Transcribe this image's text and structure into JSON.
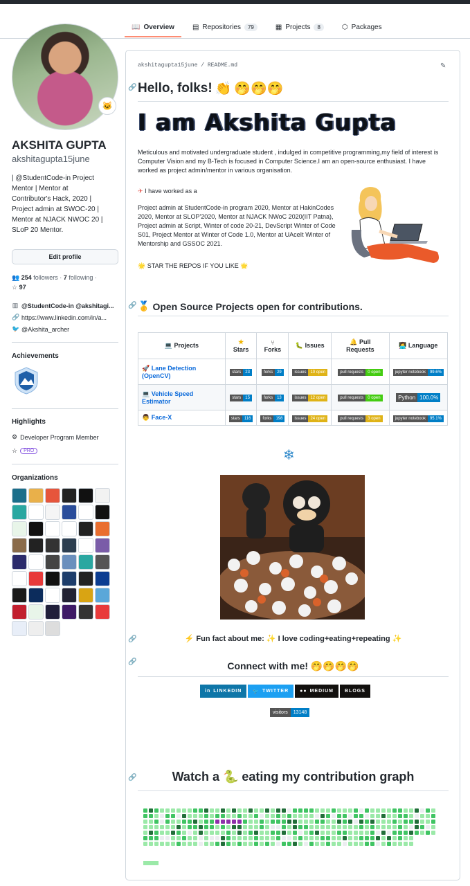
{
  "tabs": [
    {
      "label": "Overview",
      "count": ""
    },
    {
      "label": "Repositories",
      "count": "79"
    },
    {
      "label": "Projects",
      "count": "8"
    },
    {
      "label": "Packages",
      "count": ""
    }
  ],
  "profile": {
    "name": "AKSHITA GUPTA",
    "username": "akshitagupta15june",
    "bio_lines": [
      "| @StudentCode-in Project",
      "Mentor | Mentor at",
      "Contributor's Hack, 2020 |",
      "Project admin at SWOC-20 |",
      "Mentor at NJACK NWOC 20 |",
      "SLoP 20 Mentor."
    ],
    "edit_label": "Edit profile",
    "followers": "254",
    "followers_label": "followers",
    "following": "7",
    "following_label": "following",
    "stars": "97",
    "company": "@StudentCode-in @akshitagi...",
    "website": "https://www.linkedin.com/in/a...",
    "twitter": "@Akshita_archer"
  },
  "achievements": {
    "title": "Achievements"
  },
  "highlights": {
    "title": "Highlights",
    "item1": "Developer Program Member",
    "pro": "PRO"
  },
  "organizations": {
    "title": "Organizations",
    "colors": [
      "#1b6e8a",
      "#e9b04a",
      "#e6553b",
      "#222",
      "#111",
      "#f2f2f2",
      "#2aa7a1",
      "#fff",
      "#f5f5f5",
      "#2a4d9a",
      "#fff",
      "#111",
      "#e8f5e9",
      "#111",
      "#fff",
      "#fff",
      "#222",
      "#e96e2f",
      "#8a6b4a",
      "#222",
      "#333",
      "#2c3e50",
      "#fff",
      "#7a5ca8",
      "#2b2b6b",
      "#fff",
      "#444",
      "#6a8fbd",
      "#2aa7a1",
      "#555",
      "#fff",
      "#e83a3a",
      "#111",
      "#1d3d6b",
      "#222",
      "#0b3d91",
      "#1a1a1a",
      "#0c2c5c",
      "#fff",
      "#223",
      "#d9a413",
      "#5aa7d9",
      "#c21f2f",
      "#e8f5e9",
      "#1f1f3a",
      "#3d1a66",
      "#333",
      "#e83a3a",
      "#e8eef8",
      "#eee",
      "#ddd"
    ]
  },
  "readme": {
    "path": "akshitagupta15june / README.md",
    "hello": "Hello, folks!",
    "banner": "I am Akshita Gupta",
    "intro": "Meticulous and motivated undergraduate student , indulged in competitive programming,my field of interest is Computer Vision and my B-Tech is focused in Computer Science.I am an open-source enthusiast. I have worked as project admin/mentor in various organisation.",
    "worked": "I have worked as a",
    "roles": "Project admin at StudentCode-in program 2020, Mentor at HakinCodes 2020, Mentor at SLOP'2020, Mentor at NJACK NWoC 2020(IIT Patna), Project admin at Script, Winter of code 20-21, DevScript Winter of Code S01, Project Mentor at Winter of Code 1.0, Mentor at UAceIt Winter of Mentorship and GSSOC 2021.",
    "star": "STAR THE REPOS IF YOU LIKE",
    "open_source_title": "Open Source Projects open for contributions.",
    "table": {
      "headers": [
        "Projects",
        "Stars",
        "Forks",
        "Issues",
        "Pull Requests",
        "Language"
      ],
      "rows": [
        {
          "name": "Lane Detection (OpenCV)",
          "stars": "23",
          "forks": "29",
          "issues": "10 open",
          "prs": "0 open",
          "lang": "jupyter notebook",
          "lang_pct": "99.6%"
        },
        {
          "name": "Vehicle Speed Estimator",
          "stars": "15",
          "forks": "13",
          "issues": "12 open",
          "prs": "0 open",
          "lang": "Python",
          "lang_pct": "100.0%"
        },
        {
          "name": "Face-X",
          "stars": "116",
          "forks": "198",
          "issues": "24 open",
          "prs": "3 open",
          "lang": "jupyter notebook",
          "lang_pct": "95.1%"
        }
      ],
      "stars_label": "stars",
      "forks_label": "forks",
      "issues_label": "issues",
      "prs_label": "pull requests"
    },
    "fact_prefix": "Fun fact about me:",
    "fact_text": "I love coding+eating+repeating",
    "connect": "Connect with me!",
    "socials": [
      {
        "label": "LINKEDIN",
        "color": "#0e76a8"
      },
      {
        "label": "TWITTER",
        "color": "#1ca0f2"
      },
      {
        "label": "MEDIUM",
        "color": "#12100e"
      },
      {
        "label": "BLOGS",
        "color": "#12100e"
      }
    ],
    "visitors_label": "visitors",
    "visitors_count": "13148",
    "watch": "Watch a 🐍 eating my contribution graph"
  },
  "colors": {
    "accent": "#fd8c73",
    "link": "#0969da",
    "green1": "#9be9a8",
    "green2": "#40c463",
    "green3": "#216e39",
    "snake": "#8e2faa"
  }
}
